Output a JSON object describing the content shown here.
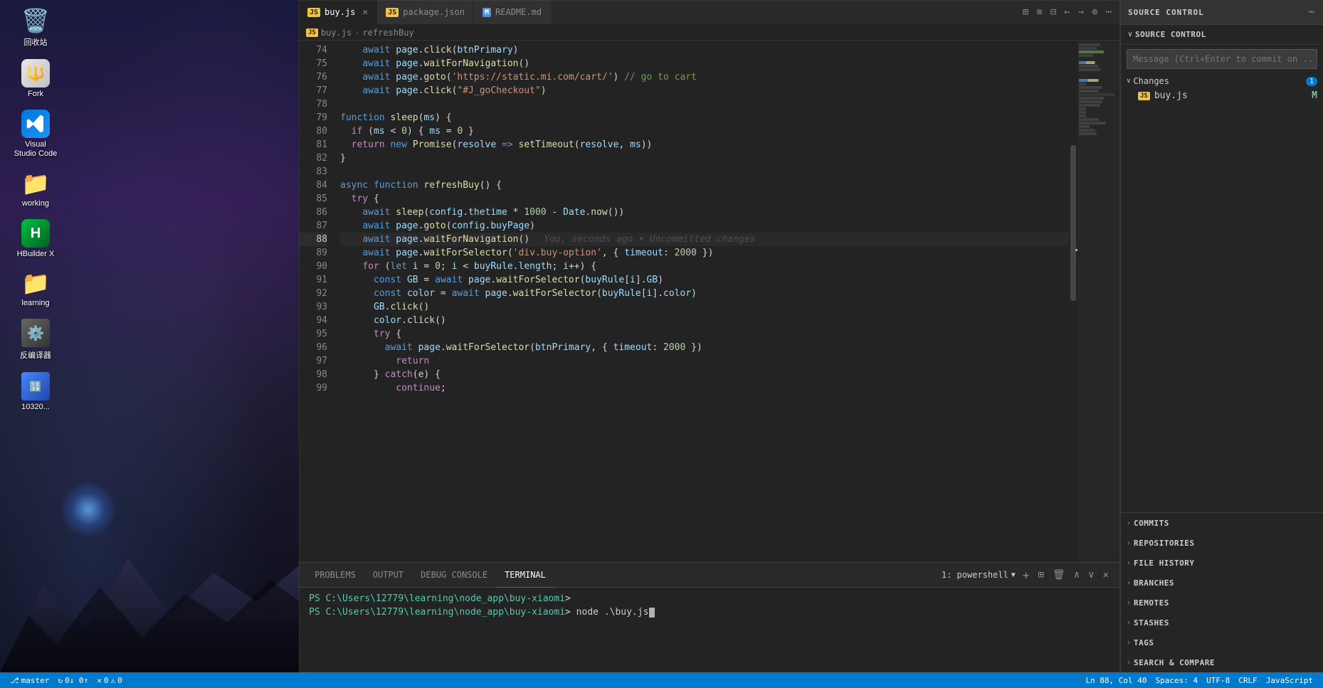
{
  "window": {
    "title": "Visual Studio Code"
  },
  "tabs": [
    {
      "id": "buy-js",
      "label": "buy.js",
      "icon": "JS",
      "active": true,
      "dirty": false
    },
    {
      "id": "package-json",
      "label": "package.json",
      "icon": "JS",
      "active": false,
      "dirty": false
    },
    {
      "id": "readme-md",
      "label": "README.md",
      "icon": "M",
      "active": false,
      "dirty": false
    }
  ],
  "breadcrumb": {
    "file": "buy.js",
    "separator": "›",
    "function": "refreshBuy"
  },
  "codeLines": [
    {
      "num": 74,
      "content": "    await page.click(btnPrimary)"
    },
    {
      "num": 75,
      "content": "    await page.waitForNavigation()"
    },
    {
      "num": 76,
      "content": "    await page.goto('https://static.mi.com/cart/') // go to cart"
    },
    {
      "num": 77,
      "content": "    await page.click(\"#J_goCheckout\")"
    },
    {
      "num": 78,
      "content": ""
    },
    {
      "num": 79,
      "content": "function sleep(ms) {"
    },
    {
      "num": 80,
      "content": "  if (ms < 0) { ms = 0 }"
    },
    {
      "num": 81,
      "content": "  return new Promise(resolve => setTimeout(resolve, ms))"
    },
    {
      "num": 82,
      "content": "}"
    },
    {
      "num": 83,
      "content": ""
    },
    {
      "num": 84,
      "content": "async function refreshBuy() {"
    },
    {
      "num": 85,
      "content": "  try {"
    },
    {
      "num": 86,
      "content": "    await sleep(config.thetime * 1000 - Date.now())"
    },
    {
      "num": 87,
      "content": "    await page.goto(config.buyPage)"
    },
    {
      "num": 88,
      "content": "    await page.waitForNavigation()",
      "active": true,
      "ghost": "You, seconds ago • Uncommitted changes"
    },
    {
      "num": 89,
      "content": "    await page.waitForSelector('div.buy-option', { timeout: 2000 })"
    },
    {
      "num": 90,
      "content": "    for (let i = 0; i < buyRule.length; i++) {"
    },
    {
      "num": 91,
      "content": "      const GB = await page.waitForSelector(buyRule[i].GB)"
    },
    {
      "num": 92,
      "content": "      const color = await page.waitForSelector(buyRule[i].color)"
    },
    {
      "num": 93,
      "content": "      GB.click()"
    },
    {
      "num": 94,
      "content": "      color.click()"
    },
    {
      "num": 95,
      "content": "      try {"
    },
    {
      "num": 96,
      "content": "        await page.waitForSelector(btnPrimary, { timeout: 2000 })"
    },
    {
      "num": 97,
      "content": "          return"
    },
    {
      "num": 98,
      "content": "      } catch(e) {"
    },
    {
      "num": 99,
      "content": "          continue;"
    }
  ],
  "terminal": {
    "tabs": [
      {
        "label": "PROBLEMS",
        "active": false
      },
      {
        "label": "OUTPUT",
        "active": false
      },
      {
        "label": "DEBUG CONSOLE",
        "active": false
      },
      {
        "label": "TERMINAL",
        "active": true
      }
    ],
    "currentSession": "1: powershell",
    "lines": [
      "PS C:\\Users\\12779\\learning\\node_app\\buy-xiaomi> ",
      "PS C:\\Users\\12779\\learning\\node_app\\buy-xiaomi> node .\\buy.js"
    ]
  },
  "sourceControl": {
    "panelTitle": "SOURCE CONTROL",
    "subTitle": "SOURCE CONTROL",
    "messagePlaceholder": "Message (Ctrl+Enter to commit on ...",
    "changesSection": {
      "title": "Changes",
      "badge": "1",
      "files": [
        {
          "name": "buy.js",
          "icon": "JS",
          "status": "M"
        }
      ]
    },
    "bottomSections": [
      {
        "id": "commits",
        "label": "COMMITS"
      },
      {
        "id": "repositories",
        "label": "REPOSITORIES"
      },
      {
        "id": "file-history",
        "label": "FILE HISTORY"
      },
      {
        "id": "branches",
        "label": "BRANCHES"
      },
      {
        "id": "remotes",
        "label": "REMOTES"
      },
      {
        "id": "stashes",
        "label": "STASHES"
      },
      {
        "id": "tags",
        "label": "TAGS"
      },
      {
        "id": "search-compare",
        "label": "SEARCH & COMPARE"
      }
    ]
  },
  "desktop": {
    "icons": [
      {
        "id": "recycle-bin",
        "label": "回收站",
        "emoji": "🗑️"
      },
      {
        "id": "fork",
        "label": "Fork",
        "emoji": "🔱"
      },
      {
        "id": "vscode",
        "label": "Visual\nStudio Code",
        "emoji": "💙"
      },
      {
        "id": "working",
        "label": "working",
        "emoji": "📁"
      },
      {
        "id": "hbuilder",
        "label": "HBuilder X",
        "emoji": "🟩"
      },
      {
        "id": "learning",
        "label": "learning",
        "emoji": "📁"
      },
      {
        "id": "translate",
        "label": "反编译器",
        "emoji": "⚙️"
      },
      {
        "id": "number",
        "label": "10320...",
        "emoji": "🔢"
      }
    ]
  },
  "statusBar": {
    "branch": "master",
    "sync": "0↓ 0↑",
    "errors": "0",
    "warnings": "0",
    "position": "Ln 88, Col 40",
    "spaces": "Spaces: 4",
    "encoding": "UTF-8",
    "lineEnding": "CRLF",
    "language": "JavaScript"
  }
}
